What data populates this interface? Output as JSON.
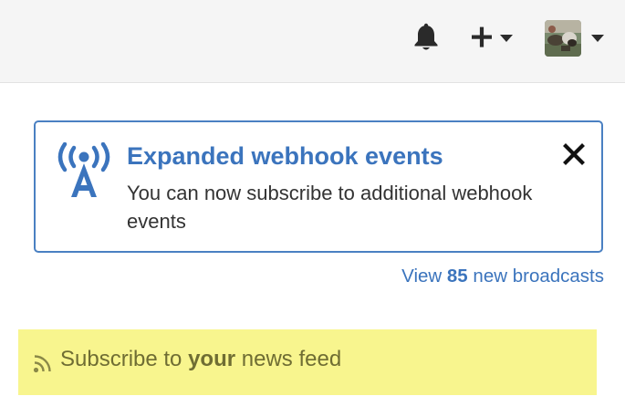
{
  "header": {
    "notifications_icon": "bell-icon",
    "create_icon": "plus-icon",
    "avatar_icon": "user-avatar"
  },
  "broadcast": {
    "icon": "broadcast-tower-icon",
    "title": "Expanded webhook events",
    "body": "You can now subscribe to additional webhook events",
    "close_icon": "close-icon",
    "accent_color": "#3b74bd"
  },
  "broadcasts_link": {
    "prefix": "View ",
    "count": "85",
    "suffix": " new broadcasts"
  },
  "subscribe": {
    "icon": "rss-icon",
    "prefix": "Subscribe to ",
    "emphasis": "your",
    "suffix": " news feed",
    "background_color": "#f8f58e"
  }
}
